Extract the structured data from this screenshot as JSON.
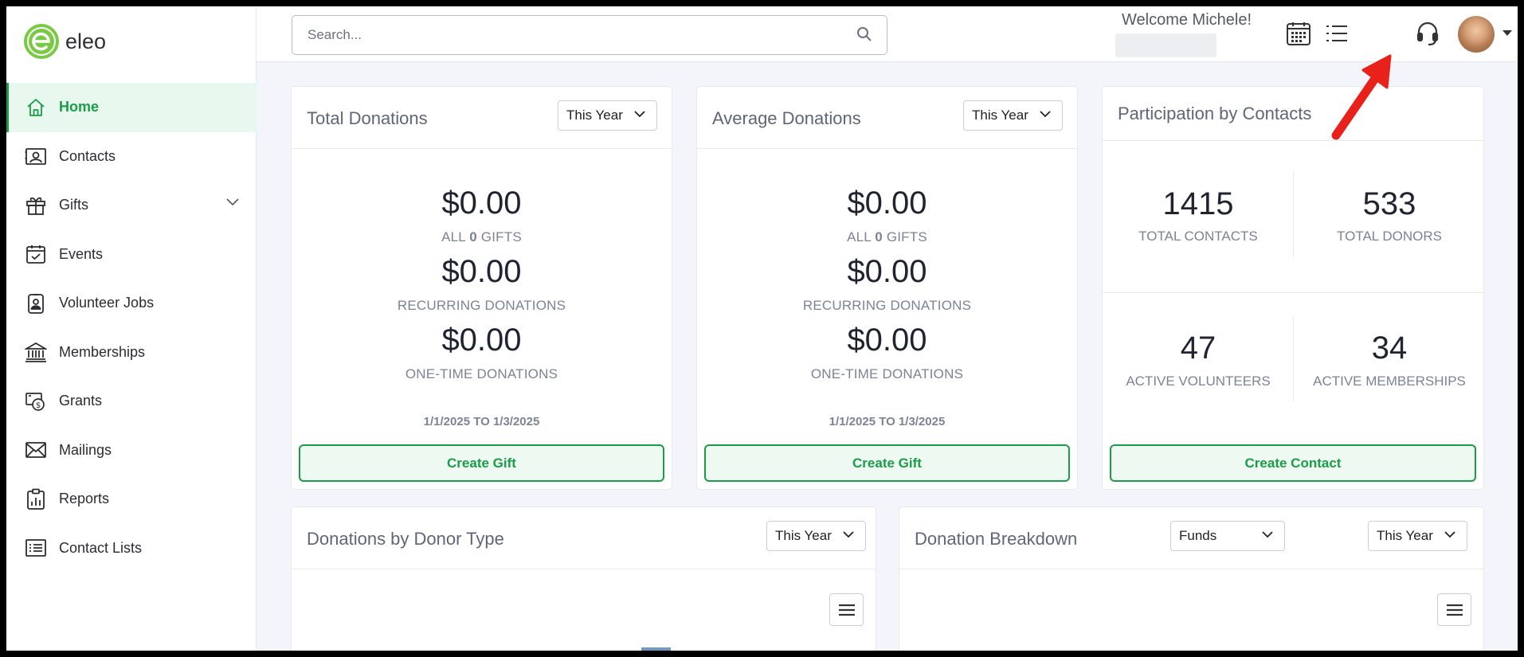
{
  "app": {
    "logo_text": "eleo",
    "brand_color": "#1a9c48"
  },
  "sidebar": {
    "items": [
      {
        "label": "Home",
        "icon": "home-icon",
        "active": true
      },
      {
        "label": "Contacts",
        "icon": "contact-card-icon"
      },
      {
        "label": "Gifts",
        "icon": "gift-icon",
        "expandable": true
      },
      {
        "label": "Events",
        "icon": "calendar-check-icon"
      },
      {
        "label": "Volunteer Jobs",
        "icon": "badge-icon"
      },
      {
        "label": "Memberships",
        "icon": "bank-icon"
      },
      {
        "label": "Grants",
        "icon": "money-icon"
      },
      {
        "label": "Mailings",
        "icon": "envelope-icon"
      },
      {
        "label": "Reports",
        "icon": "clipboard-chart-icon"
      },
      {
        "label": "Contact Lists",
        "icon": "list-icon"
      }
    ]
  },
  "header": {
    "search": {
      "placeholder": "Search...",
      "value": ""
    },
    "welcome": "Welcome Michele!",
    "icons": [
      "calendar-grid-icon",
      "list-icon",
      "headset-icon",
      "avatar"
    ]
  },
  "cards": {
    "total_donations": {
      "title": "Total Donations",
      "period": "This Year",
      "all_amount": "$0.00",
      "all_label_pre": "ALL ",
      "all_count": "0",
      "all_label_post": " GIFTS",
      "recurring_amount": "$0.00",
      "recurring_label": "RECURRING DONATIONS",
      "onetime_amount": "$0.00",
      "onetime_label": "ONE-TIME DONATIONS",
      "range": "1/1/2025 TO 1/3/2025",
      "button": "Create Gift"
    },
    "average_donations": {
      "title": "Average Donations",
      "period": "This Year",
      "all_amount": "$0.00",
      "all_label_pre": "ALL ",
      "all_count": "0",
      "all_label_post": " GIFTS",
      "recurring_amount": "$0.00",
      "recurring_label": "RECURRING DONATIONS",
      "onetime_amount": "$0.00",
      "onetime_label": "ONE-TIME DONATIONS",
      "range": "1/1/2025 TO 1/3/2025",
      "button": "Create Gift"
    },
    "participation": {
      "title": "Participation by Contacts",
      "total_contacts": "1415",
      "total_contacts_label": "TOTAL CONTACTS",
      "total_donors": "533",
      "total_donors_label": "TOTAL DONORS",
      "active_volunteers": "47",
      "active_volunteers_label": "ACTIVE VOLUNTEERS",
      "active_memberships": "34",
      "active_memberships_label": "ACTIVE MEMBERSHIPS",
      "button": "Create Contact"
    },
    "donor_type": {
      "title": "Donations by Donor Type",
      "period": "This Year"
    },
    "breakdown": {
      "title": "Donation Breakdown",
      "group": "Funds",
      "period": "This Year"
    }
  },
  "colors": {
    "arrow_annotation": "#e8221b",
    "accent": "#1a9c48"
  }
}
